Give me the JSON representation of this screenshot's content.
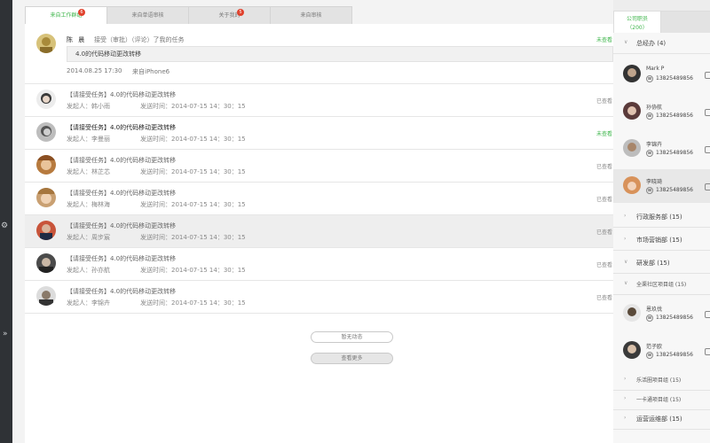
{
  "tabs": [
    {
      "label": "来自工作群组",
      "badge": "6",
      "active": true
    },
    {
      "label": "来自单语审核",
      "badge": "",
      "active": false
    },
    {
      "label": "关于我的",
      "badge": "5",
      "active": false
    },
    {
      "label": "来自审核",
      "badge": "",
      "active": false
    }
  ],
  "post": {
    "name": "陈 晨",
    "action": "接受（审批）（评论）了我的任务",
    "quote": "4.0的代码移动更改转移",
    "time": "2014.08.25   17:30",
    "device": "来自iPhone6",
    "status": "未查看"
  },
  "rows": [
    {
      "title": "【请接受任务】4.0的代码移动更改转移",
      "sender": "发起人：韩小雨",
      "sent": "发送时间：2014-07-15   14：30：15",
      "status": "已查看",
      "new": false,
      "bold": false,
      "hl": false
    },
    {
      "title": "【请接受任务】4.0的代码移动更改转移",
      "sender": "发起人：李曼丽",
      "sent": "发送时间：2014-07-15   14：30：15",
      "status": "未查看",
      "new": true,
      "bold": true,
      "hl": false
    },
    {
      "title": "【请接受任务】4.0的代码移动更改转移",
      "sender": "发起人：林芷芯",
      "sent": "发送时间：2014-07-15   14：30：15",
      "status": "已查看",
      "new": false,
      "bold": false,
      "hl": false
    },
    {
      "title": "【请接受任务】4.0的代码移动更改转移",
      "sender": "发起人：梅林海",
      "sent": "发送时间：2014-07-15   14：30：15",
      "status": "已查看",
      "new": false,
      "bold": false,
      "hl": false
    },
    {
      "title": "【请接受任务】4.0的代码移动更改转移",
      "sender": "发起人：周步宸",
      "sent": "发送时间：2014-07-15   14：30：15",
      "status": "已查看",
      "new": false,
      "bold": false,
      "hl": true
    },
    {
      "title": "【请接受任务】4.0的代码移动更改转移",
      "sender": "发起人：孙亦航",
      "sent": "发送时间：2014-07-15   14：30：15",
      "status": "已查看",
      "new": false,
      "bold": false,
      "hl": false
    },
    {
      "title": "【请接受任务】4.0的代码移动更改转移",
      "sender": "发起人：李锦卉",
      "sent": "发送时间：2014-07-15   14：30：15",
      "status": "已查看",
      "new": false,
      "bold": false,
      "hl": false
    }
  ],
  "buttons": {
    "no_more": "暂无动态",
    "more": "查看更多"
  },
  "side": {
    "tab_label": "公司职员",
    "tab_count": "（200）",
    "groups": {
      "g1": "总经办 (4)",
      "g2": "行政服务部 (15)",
      "g3": "市场营销部 (15)",
      "g4": "研发部 (15)",
      "g5": "全渠社区项目组 (15)",
      "g6": "乐活圈项目组 (15)",
      "g7": "一卡通项目组 (15)",
      "g8": "运营运维部 (15)"
    },
    "people": [
      {
        "name": "Mark P",
        "phone": "13825489856"
      },
      {
        "name": "孙协航",
        "phone": "13825489856"
      },
      {
        "name": "李锦卉",
        "phone": "13825489856"
      },
      {
        "name": "李晓琦",
        "phone": "13825489856"
      },
      {
        "name": "恩玖伐",
        "phone": "13825489856"
      },
      {
        "name": "范子欧",
        "phone": "13825489856"
      }
    ]
  },
  "colors": {
    "accent": "#3db54a",
    "badge": "#e0412c",
    "rail": "#2f3236"
  }
}
